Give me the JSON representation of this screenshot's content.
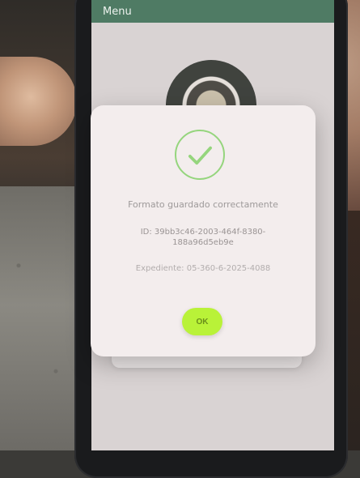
{
  "app": {
    "menu_label": "Menu"
  },
  "dialog": {
    "title": "Formato guardado correctamente",
    "id_label": "ID: 39bb3c46-2003-464f-8380-188a96d5eb9e",
    "expediente_label": "Expediente: 05-360-6-2025-4088",
    "ok_label": "OK",
    "icon": "checkmark-icon",
    "accent_color": "#b9f238"
  },
  "colors": {
    "header": "#4f7b64",
    "check": "#95d57d"
  }
}
